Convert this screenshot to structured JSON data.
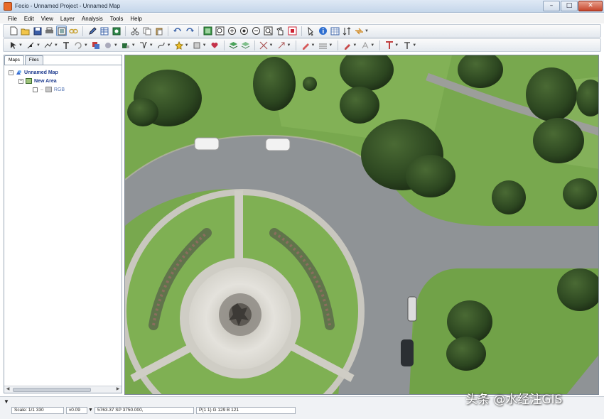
{
  "window": {
    "title": "Fecio - Unnamed Project - Unnamed Map",
    "minimize": "–",
    "maximize": "□",
    "close": "✕",
    "app_icon": "app-logo-icon"
  },
  "menu": [
    "File",
    "Edit",
    "View",
    "Layer",
    "Analysis",
    "Tools",
    "Help"
  ],
  "toolbar1": {
    "icons": [
      "new-icon",
      "open-icon",
      "save-icon",
      "print-icon",
      "layout-icon",
      "link-icon",
      "edit-icon",
      "table-icon",
      "database-icon",
      "cut-icon",
      "copy-icon",
      "paste-icon",
      "undo-icon",
      "redo-icon",
      "zoom-extent-icon",
      "zoom-in-icon",
      "zoom-out-icon",
      "zoom-previous-icon",
      "zoom-window-icon",
      "pan-icon",
      "refresh-icon",
      "identify-icon",
      "info-icon",
      "grid-icon",
      "sort-icon",
      "select-icon"
    ]
  },
  "toolbar2": {
    "icons": [
      "pointer-icon",
      "node-icon",
      "line-icon",
      "text-icon",
      "rotate-icon",
      "paint-icon",
      "layer-style-icon",
      "fill-icon",
      "measure-icon",
      "bezier-icon",
      "star-icon",
      "color-icon",
      "heart-icon",
      "stack-icon",
      "stack2-icon",
      "transform-icon",
      "snap-icon",
      "draw-icon",
      "line-style-icon",
      "brush-icon",
      "font-size-icon",
      "text-tool-icon"
    ]
  },
  "left_panel": {
    "tabs": [
      "Maps",
      "Files"
    ],
    "active_tab": "Maps",
    "tree": {
      "map": "Unnamed Map",
      "area": "New Area",
      "layer": "RGB"
    }
  },
  "status": {
    "scale": "Scale: 1/1 330",
    "version": "v0.09",
    "coords": "5763.37 SP 3750.000,",
    "pixel": "P(1 1) G 129 B 121"
  },
  "watermark": "头条 @水经注GIS",
  "colors": {
    "grass": "#74a24e",
    "road": "#8e9296",
    "tree": "#2e4a22",
    "plaza": "#d8d6cf"
  }
}
